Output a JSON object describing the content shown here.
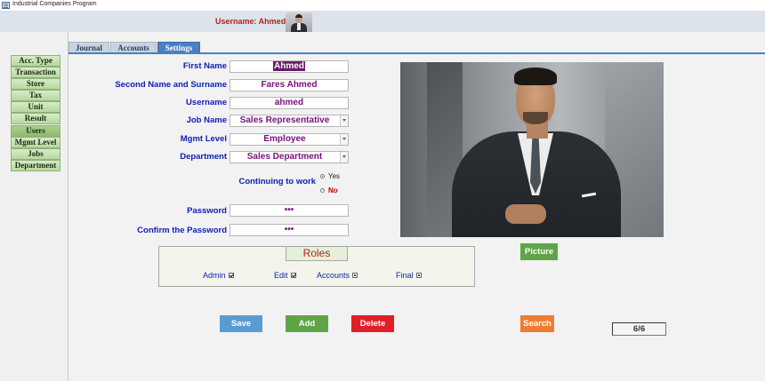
{
  "window": {
    "title": "Industrial Companies Program"
  },
  "header": {
    "username_label": "Username: Ahmed"
  },
  "sidebar": {
    "items": [
      {
        "label": "Acc. Type"
      },
      {
        "label": "Transaction"
      },
      {
        "label": "Store"
      },
      {
        "label": "Tax"
      },
      {
        "label": "Unit"
      },
      {
        "label": "Result"
      },
      {
        "label": "Users",
        "active": true
      },
      {
        "label": "Mgmt Level"
      },
      {
        "label": "Jobs"
      },
      {
        "label": "Department"
      }
    ]
  },
  "tabs": [
    {
      "label": "Journal"
    },
    {
      "label": "Accounts"
    },
    {
      "label": "Settings",
      "active": true
    }
  ],
  "form": {
    "first_name": {
      "label": "First Name",
      "value": "Ahmed"
    },
    "second_name": {
      "label": "Second Name and Surname",
      "value": "Fares Ahmed"
    },
    "username": {
      "label": "Username",
      "value": "ahmed"
    },
    "job_name": {
      "label": "Job Name",
      "value": "Sales Representative"
    },
    "mgmt_level": {
      "label": "Mgmt Level",
      "value": "Employee"
    },
    "department": {
      "label": "Department",
      "value": "Sales Department"
    },
    "continuing": {
      "label": "Continuing to work",
      "yes": "Yes",
      "no": "No",
      "selected": "Yes"
    },
    "password": {
      "label": "Password",
      "value": "•••"
    },
    "confirm_password": {
      "label": "Confirm the Password",
      "value": "•••"
    }
  },
  "roles": {
    "title": "Roles",
    "admin": {
      "label": "Admin",
      "state": "checked"
    },
    "edit": {
      "label": "Edit",
      "state": "checked"
    },
    "accounts": {
      "label": "Accounts",
      "state": "indeterminate"
    },
    "final": {
      "label": "Final",
      "state": "indeterminate"
    }
  },
  "buttons": {
    "picture": "Picture",
    "save": "Save",
    "add": "Add",
    "delete": "Delete",
    "search": "Search"
  },
  "record_counter": "6/6",
  "colors": {
    "label_blue": "#0b1fb0",
    "value_purple": "#7a0f7a",
    "title_red": "#b22222",
    "save_blue": "#5b9bd5",
    "add_green": "#5fa548",
    "delete_red": "#e11f26",
    "search_orange": "#ed7d31",
    "tab_active": "#4a7fc1"
  }
}
